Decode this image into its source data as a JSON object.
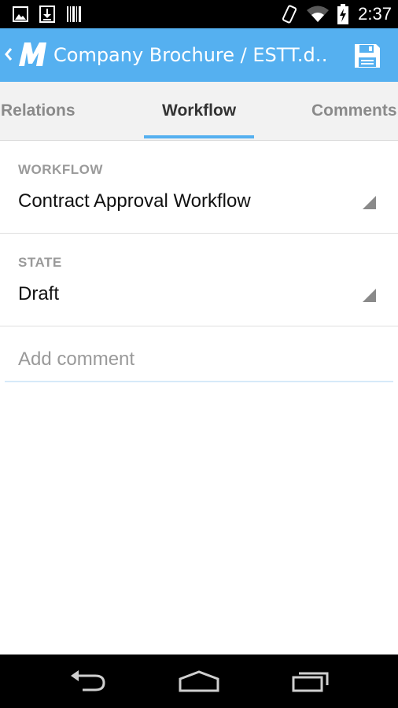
{
  "status_bar": {
    "time": "2:37",
    "left_icons": [
      "image-icon",
      "download-icon",
      "barcode-icon"
    ],
    "right_icons": [
      "rotate-icon",
      "wifi-icon",
      "battery-icon"
    ]
  },
  "app_bar": {
    "title": "Company Brochure / ESTT.d…",
    "background": "#55b0f0",
    "icons": [
      "back-icon",
      "logo-icon",
      "save-icon"
    ]
  },
  "tabs": {
    "items": [
      {
        "label": "Relations",
        "active": false
      },
      {
        "label": "Workflow",
        "active": true
      },
      {
        "label": "Comments",
        "active": false
      }
    ],
    "indicator_color": "#55b0f0"
  },
  "workflow": {
    "label": "WORKFLOW",
    "value": "Contract Approval Workflow"
  },
  "state": {
    "label": "STATE",
    "value": "Draft"
  },
  "comment": {
    "placeholder": "Add comment",
    "value": ""
  },
  "nav_bar": {
    "icons": [
      "back-nav-icon",
      "home-icon",
      "recent-apps-icon"
    ]
  }
}
